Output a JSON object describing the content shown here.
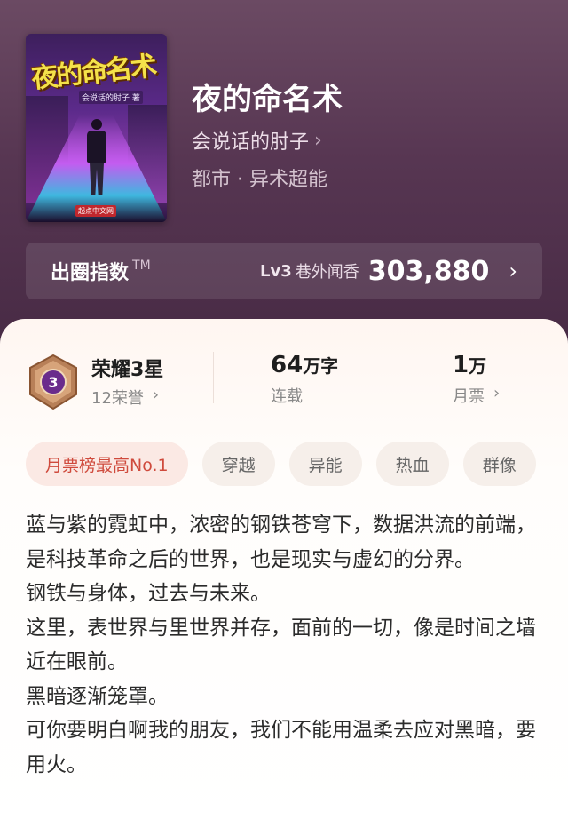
{
  "book": {
    "cover_title": "夜的命名术",
    "cover_author": "会说话的肘子 著",
    "cover_publisher": "起点中文网",
    "title": "夜的命名术",
    "author": "会说话的肘子",
    "genre": "都市 · 异术超能"
  },
  "index": {
    "label": "出圈指数",
    "tm": "TM",
    "level": "Lv3",
    "level_desc": "巷外闻香",
    "value": "303,880"
  },
  "stats": {
    "honor_title": "荣耀3星",
    "honor_count": "12荣誉",
    "badge_number": "3",
    "words_value": "64",
    "words_unit": "万字",
    "words_label": "连载",
    "tickets_value": "1",
    "tickets_unit": "万",
    "tickets_label": "月票"
  },
  "tags": [
    "月票榜最高No.1",
    "穿越",
    "异能",
    "热血",
    "群像"
  ],
  "description": [
    "蓝与紫的霓虹中，浓密的钢铁苍穹下，数据洪流的前端，是科技革命之后的世界，也是现实与虚幻的分界。",
    "钢铁与身体，过去与未来。",
    "这里，表世界与里世界并存，面前的一切，像是时间之墙近在眼前。",
    "黑暗逐渐笼罩。",
    "可你要明白啊我的朋友，我们不能用温柔去应对黑暗，要用火。"
  ],
  "colors": {
    "header_bg": "#573652",
    "hot_tag": "#cf4a3c",
    "badge_bronze": "#a8744a",
    "badge_purple": "#6a2c8c"
  }
}
